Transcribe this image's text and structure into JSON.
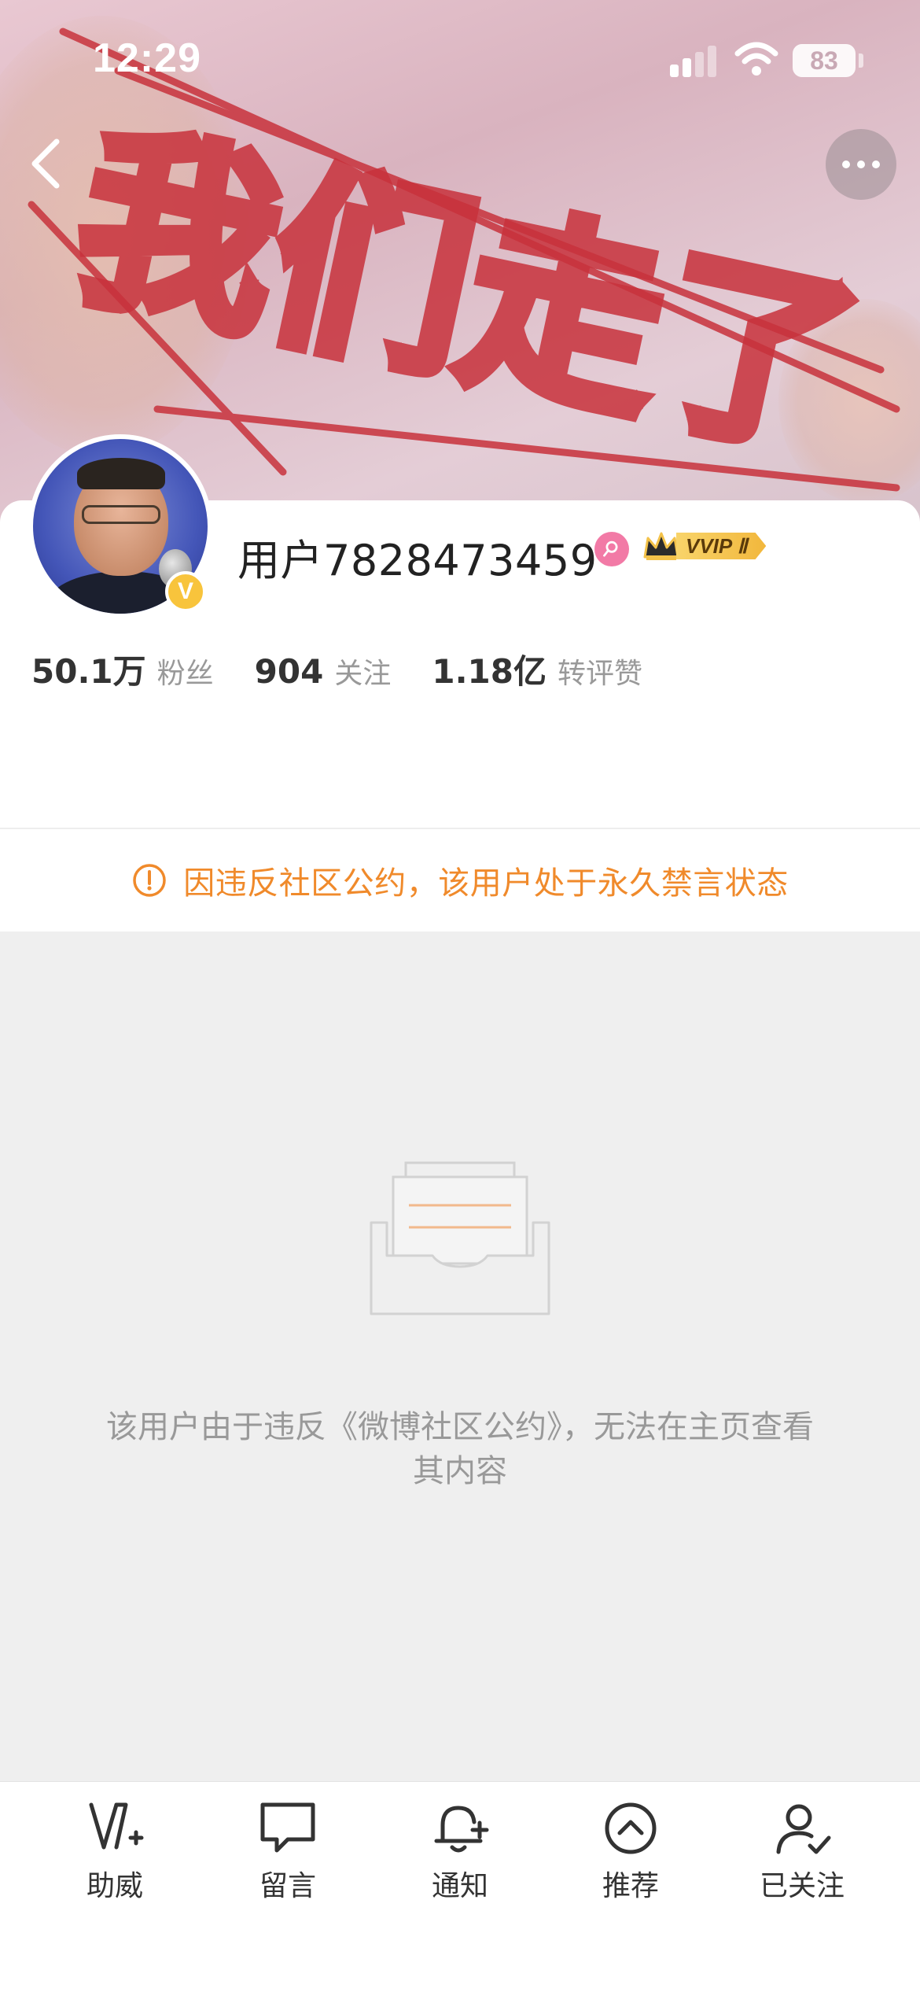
{
  "status_bar": {
    "time": "12:29",
    "battery": "83",
    "signal_bars_active": 2
  },
  "header": {
    "banner_text": "我们走了",
    "banner_accent_color": "#c8323c"
  },
  "nav": {
    "back_icon": "chevron-left-icon",
    "more_icon": "more-dots-icon"
  },
  "profile": {
    "username": "用户7828473459",
    "gender_icon": "female-icon",
    "vip_badge": "VVIP Ⅱ",
    "verify_badge": "V",
    "stats": [
      {
        "value": "50.1万",
        "label": "粉丝"
      },
      {
        "value": "904",
        "label": "关注"
      },
      {
        "value": "1.18亿",
        "label": "转评赞"
      }
    ]
  },
  "notice": {
    "icon": "alert-circle-icon",
    "text": "因违反社区公约，该用户处于永久禁言状态",
    "color": "#f08a2b"
  },
  "empty_state": {
    "icon": "empty-box-icon",
    "text": "该用户由于违反《微博社区公约》，无法在主页查看其内容"
  },
  "bottom_tabs": [
    {
      "label": "助威",
      "icon": "cheer-v-icon"
    },
    {
      "label": "留言",
      "icon": "message-icon"
    },
    {
      "label": "通知",
      "icon": "bell-add-icon"
    },
    {
      "label": "推荐",
      "icon": "recommend-up-icon"
    },
    {
      "label": "已关注",
      "icon": "user-check-icon"
    }
  ]
}
